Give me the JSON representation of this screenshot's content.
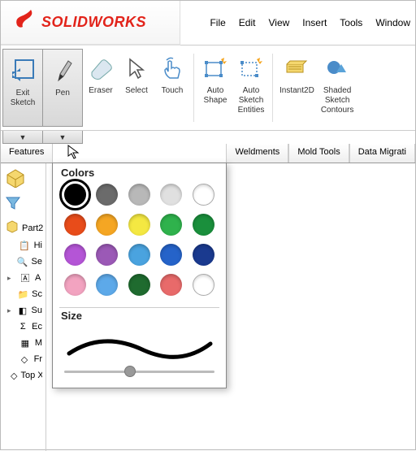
{
  "app": {
    "name": "SOLIDWORKS"
  },
  "menu": [
    "File",
    "Edit",
    "View",
    "Insert",
    "Tools",
    "Window"
  ],
  "ribbon": {
    "exit_sketch": "Exit\nSketch",
    "pen": "Pen",
    "eraser": "Eraser",
    "select": "Select",
    "touch": "Touch",
    "auto_shape": "Auto\nShape",
    "auto_sketch_entities": "Auto\nSketch\nEntities",
    "instant2d": "Instant2D",
    "shaded_contours": "Shaded\nSketch\nContours"
  },
  "tabs": {
    "features": "Features",
    "weldments": "Weldments",
    "mold_tools": "Mold Tools",
    "data_migration": "Data Migrati"
  },
  "tree": {
    "part": "Part2",
    "items": [
      "Hi",
      "Se",
      "A",
      "Sc",
      "Su",
      "Ec",
      "M",
      "Fr",
      "Top XZ"
    ]
  },
  "popup": {
    "colors_label": "Colors",
    "size_label": "Size",
    "colors": [
      {
        "hex": "#000000",
        "selected": true
      },
      {
        "hex": "#6b6b6b"
      },
      {
        "hex": "#b8b8b8"
      },
      {
        "hex": "#e0e0e0"
      },
      {
        "hex": "#ffffff",
        "hollow": true
      },
      {
        "hex": "#e84c1a"
      },
      {
        "hex": "#f5a623"
      },
      {
        "hex": "#f4e842"
      },
      {
        "hex": "#2fb24c"
      },
      {
        "hex": "#1a8f3c"
      },
      {
        "hex": "#b455d6"
      },
      {
        "hex": "#9b59b6"
      },
      {
        "hex": "#4aa3df"
      },
      {
        "hex": "#2563c9"
      },
      {
        "hex": "#1a3a8f"
      },
      {
        "hex": "#f2a3c0"
      },
      {
        "hex": "#5da9e9"
      },
      {
        "hex": "#1f6b2f"
      },
      {
        "hex": "#e86a6a"
      },
      {
        "hex": "#ffffff",
        "hollow": true
      }
    ]
  }
}
